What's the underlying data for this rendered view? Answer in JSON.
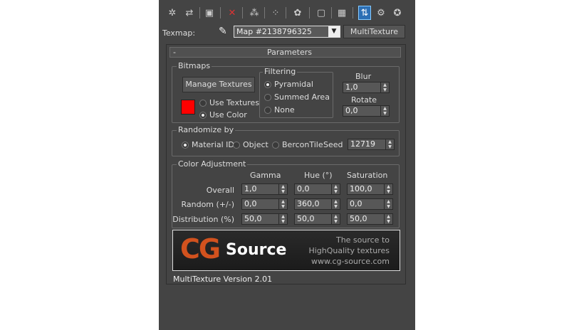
{
  "toolbar": {
    "icons": [
      "pick-material-icon",
      "put-to-scene-icon",
      "assign-to-selection-icon",
      "delete-icon",
      "copy-map-icon",
      "make-unique-icon",
      "put-to-library-icon",
      "material-id-icon",
      "show-map-icon",
      "show-end-result-icon",
      "go-to-parent-icon",
      "go-forward-icon",
      "options-icon"
    ]
  },
  "texmap": {
    "label": "Texmap:",
    "map_name": "Map #2138796325",
    "type_button": "MultiTexture"
  },
  "rollout": {
    "collapse": "-",
    "title": "Parameters"
  },
  "bitmaps": {
    "title": "Bitmaps",
    "manage_button": "Manage Textures",
    "swatch_color": "#ff0000",
    "use_textures": "Use Textures",
    "use_color": "Use Color",
    "selected": "Use Color",
    "filtering": {
      "title": "Filtering",
      "options": [
        "Pyramidal",
        "Summed Area",
        "None"
      ],
      "selected": "Pyramidal"
    },
    "blur_label": "Blur",
    "blur_value": "1,0",
    "rotate_label": "Rotate",
    "rotate_value": "0,0"
  },
  "randomize": {
    "title": "Randomize by",
    "options": [
      "Material ID",
      "Object",
      "BerconTile"
    ],
    "selected": "Material ID",
    "seed_label": "Seed",
    "seed_value": "12719"
  },
  "color_adjustment": {
    "title": "Color Adjustment",
    "columns": [
      "Gamma",
      "Hue (°)",
      "Saturation"
    ],
    "rows": [
      {
        "label": "Overall",
        "values": [
          "1,0",
          "0,0",
          "100,0"
        ]
      },
      {
        "label": "Random (+/-)",
        "values": [
          "0,0",
          "360,0",
          "0,0"
        ]
      },
      {
        "label": "Distribution (%)",
        "values": [
          "50,0",
          "50,0",
          "50,0"
        ]
      }
    ]
  },
  "banner": {
    "logo_cg": "CG",
    "logo_source": "Source",
    "tagline1": "The source to",
    "tagline2": "HighQuality textures",
    "url": "www.cg-source.com"
  },
  "version": "MultiTexture Version 2.01"
}
